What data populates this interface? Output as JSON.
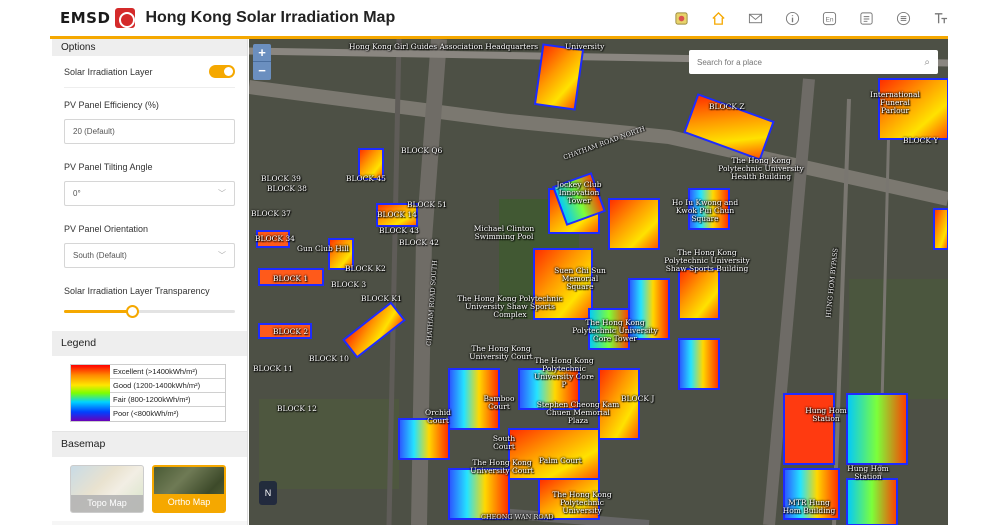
{
  "header": {
    "logo_text": "EMSD",
    "title": "Hong Kong Solar Irradiation Map",
    "icons": [
      "layers-icon",
      "home-icon",
      "mail-icon",
      "info-icon",
      "language-icon",
      "news-icon",
      "list-icon",
      "text-size-icon"
    ]
  },
  "sidebar": {
    "options_title": "Options",
    "solar_layer_label": "Solar Irradiation Layer",
    "solar_layer_on": true,
    "efficiency_label": "PV Panel Efficiency (%)",
    "efficiency_value": "20  (Default)",
    "tilt_label": "PV Panel Tilting Angle",
    "tilt_value": "0°",
    "orientation_label": "PV Panel Orientation",
    "orientation_value": "South (Default)",
    "transparency_label": "Solar Irradiation Layer Transparency",
    "transparency_fraction": 0.4,
    "legend_title": "Legend",
    "legend": [
      "Excellent (>1400kWh/m²)",
      "Good (1200-1400kWh/m²)",
      "Fair (800-1200kWh/m²)",
      "Poor (<800kWh/m²)"
    ],
    "basemap_title": "Basemap",
    "basemaps": {
      "topo": "Topo Map",
      "ortho": "Ortho Map"
    },
    "selected_basemap": "Ortho Map"
  },
  "map": {
    "zoom_in": "+",
    "zoom_out": "−",
    "search_placeholder": "Search for a place",
    "north": "N",
    "labels": {
      "hkgirl": "Hong Kong Girl Guides Association Headquarters",
      "university": "University",
      "block_z": "BLOCK Z",
      "chatham_road_north": "CHATHAM ROAD NORTH",
      "block_q6": "BLOCK Q6",
      "block_38": "BLOCK 38",
      "block_39": "BLOCK 39",
      "block_45": "BLOCK 45",
      "block_37": "BLOCK 37",
      "block_34": "BLOCK 34",
      "block_14": "BLOCK 14",
      "block_51": "BLOCK 51",
      "block_43": "BLOCK 43",
      "block_42": "BLOCK 42",
      "gun_club_hill": "Gun Club Hill",
      "block_1": "BLOCK 1",
      "block_k2": "BLOCK K2",
      "block_3": "BLOCK 3",
      "block_k1": "BLOCK K1",
      "block_2": "BLOCK 2",
      "block_10": "BLOCK 10",
      "block_11": "BLOCK 11",
      "block_12": "BLOCK 12",
      "chatham_road_south": "CHATHAM ROAD SOUTH",
      "jockey_club": "Jockey Club Innovation Tower",
      "polyu_health": "The Hong Kong Polytechnic University Health Building",
      "ho_iu_kwong": "Ho Iu Kwong and Kwok Pui Chun Square",
      "michael_clinton": "Michael Clinton Swimming Pool",
      "shaw": "The Hong Kong Polytechnic University Shaw Sports Building",
      "suen_chi_sun": "Suen Chi Sun Memorial Square",
      "sports_complex": "The Hong Kong Polytechnic University Shaw Sports Complex",
      "core": "The Hong Kong Polytechnic University Core Tower",
      "uni_court_a": "The Hong Kong University Court",
      "uni_core_p": "The Hong Kong Polytechnic University Core P",
      "orchid": "Orchid Court",
      "bamboo": "Bamboo Court",
      "stephen": "Stephen Cheong Kam Chuen Memorial Plaza",
      "south_court": "South Court",
      "hk_uni_court": "The Hong Kong University Court",
      "palm": "Palm Court",
      "polyu": "The Hong Kong Polytechnic University",
      "hung_hom": "Hung Hom Station",
      "hung_hom_2": "Hung Hom Station",
      "mtr_hh": "MTR Hung Hom Building",
      "international": "International Funeral Parlour",
      "hh_bypass": "HUNG HOM BYPASS",
      "block_j": "BLOCK J",
      "cheong_wan": "CHEONG WAN ROAD",
      "block_y": "BLOCK Y"
    }
  },
  "colors": {
    "accent": "#f5a800",
    "brand_red": "#d42a2a"
  }
}
